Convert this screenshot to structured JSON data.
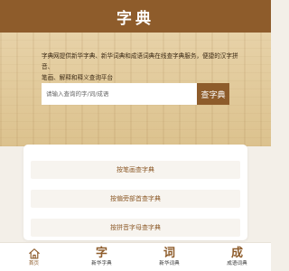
{
  "header": {
    "title": "字典"
  },
  "hero": {
    "intro_line1": "字典网提供新华字典、新华词典和成语词典在线查字典服务，便捷的汉字拼音、",
    "intro_line2": "笔画、解释和释义查询平台"
  },
  "search": {
    "placeholder": "请输入查询的字/词/成语",
    "value": "",
    "button_label": "查字典"
  },
  "links": [
    {
      "label": "按笔画查字典"
    },
    {
      "label": "按偏旁部首查字典"
    },
    {
      "label": "按拼音字母查字典"
    }
  ],
  "tabbar": {
    "items": [
      {
        "icon": "home-icon",
        "glyph": "",
        "label": "首页",
        "active": true
      },
      {
        "icon": "zi-glyph-icon",
        "glyph": "字",
        "label": "新华字典",
        "active": false
      },
      {
        "icon": "ci-glyph-icon",
        "glyph": "词",
        "label": "新华词典",
        "active": false
      },
      {
        "icon": "cheng-glyph-icon",
        "glyph": "成",
        "label": "成语词典",
        "active": false
      }
    ]
  },
  "colors": {
    "brand": "#8e5c2b",
    "page_background": "#f3efe8",
    "card_background": "#ffffff",
    "link_text": "#8e5c2b"
  }
}
